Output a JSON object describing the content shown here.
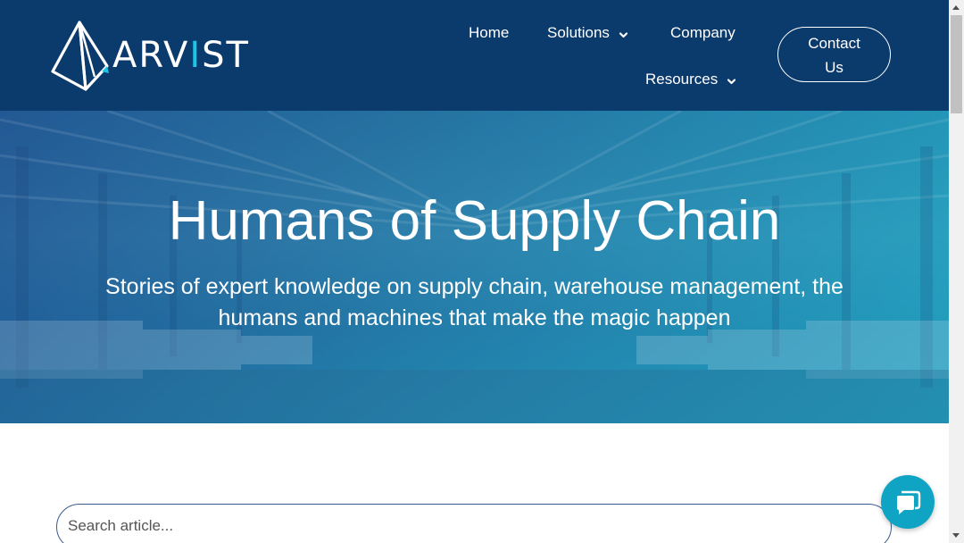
{
  "brand": {
    "name_part1": "ARV",
    "name_accent": "I",
    "name_part2": "ST"
  },
  "nav": {
    "home": "Home",
    "solutions": "Solutions",
    "company": "Company",
    "resources": "Resources",
    "contact_line1": "Contact",
    "contact_line2": "Us"
  },
  "hero": {
    "title": "Humans of Supply Chain",
    "subtitle": "Stories of expert knowledge on supply chain, warehouse management, the humans and machines that make the magic happen"
  },
  "search": {
    "placeholder": "Search article..."
  },
  "icons": {
    "logo": "pyramid-logo-icon",
    "solutions_chevron": "chevron-down-icon",
    "resources_chevron": "chevron-down-icon",
    "chat": "chat-bubble-icon"
  },
  "colors": {
    "header_bg": "#0b3a6c",
    "accent": "#1cc6e6",
    "chat_bg": "#0fa4c4"
  }
}
